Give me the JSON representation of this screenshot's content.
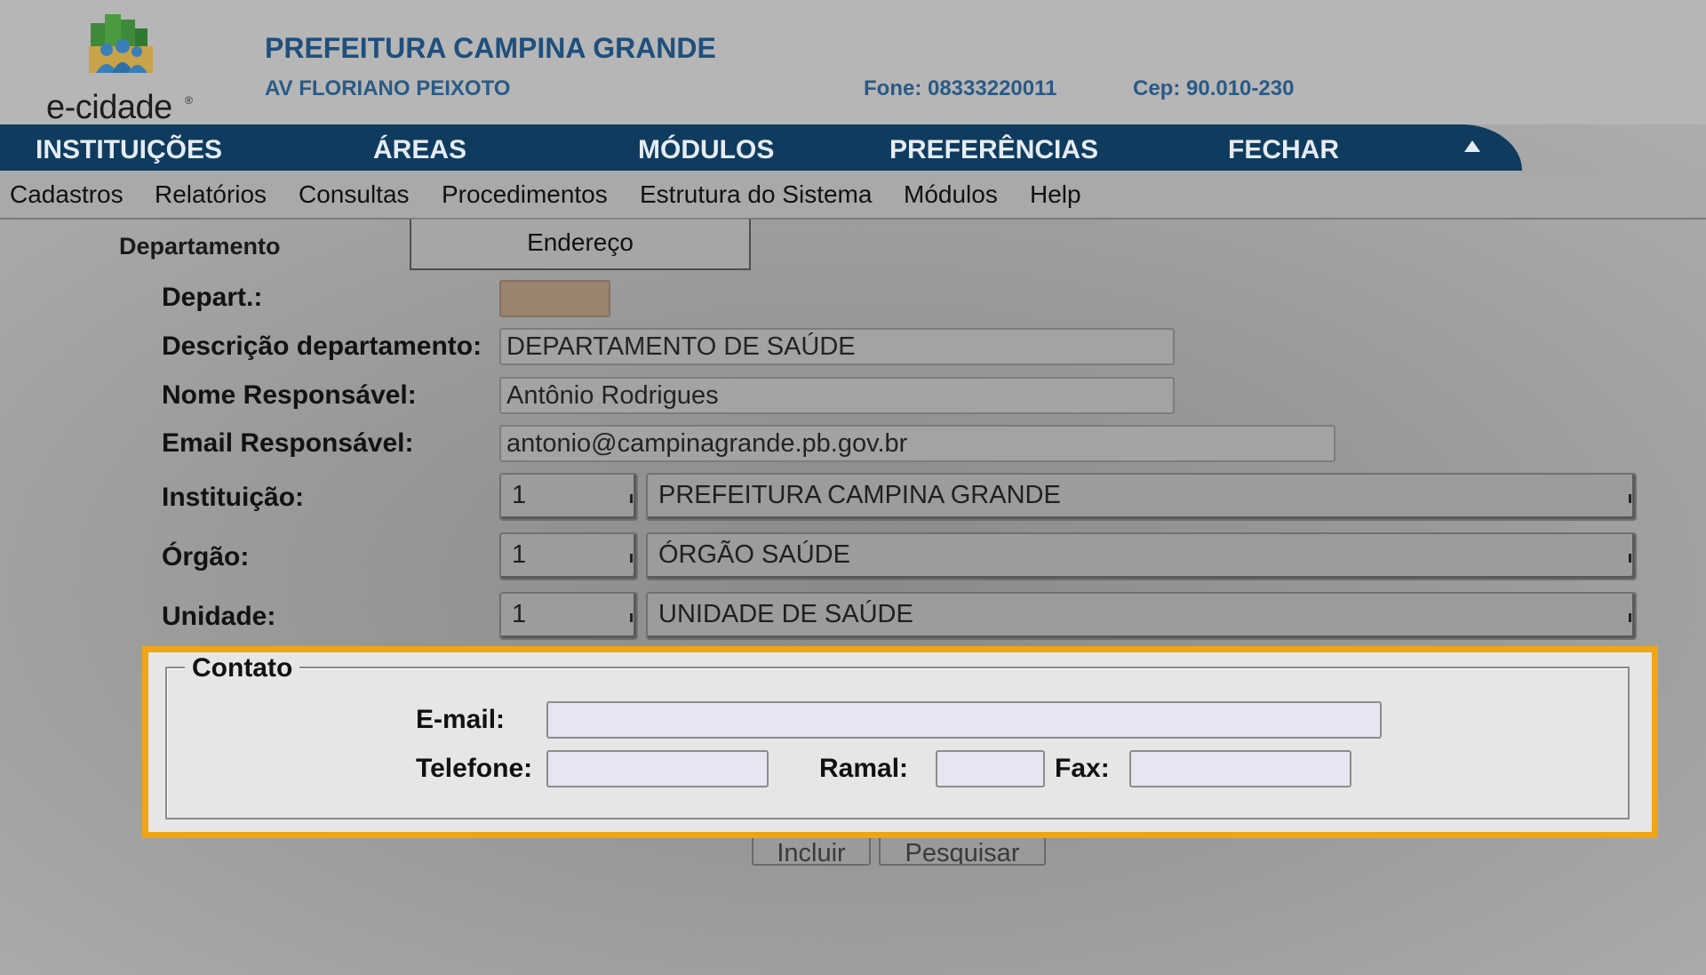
{
  "brand": {
    "logo_text": "e-cidade",
    "logo_mark": "®"
  },
  "header": {
    "title": "PREFEITURA CAMPINA GRANDE",
    "address": "AV FLORIANO PEIXOTO",
    "phone": "Fone: 08333220011",
    "cep": "Cep: 90.010-230"
  },
  "top_nav": {
    "items": [
      {
        "label": "INSTITUIÇÕES"
      },
      {
        "label": "ÁREAS"
      },
      {
        "label": "MÓDULOS"
      },
      {
        "label": "PREFERÊNCIAS"
      },
      {
        "label": "FECHAR"
      }
    ],
    "collapse_icon": "triangle-up-icon"
  },
  "menu": {
    "items": [
      {
        "label": "Cadastros"
      },
      {
        "label": "Relatórios"
      },
      {
        "label": "Consultas"
      },
      {
        "label": "Procedimentos"
      },
      {
        "label": "Estrutura do Sistema"
      },
      {
        "label": "Módulos"
      },
      {
        "label": "Help"
      }
    ]
  },
  "tabs": {
    "active": "Departamento",
    "other": "Endereço"
  },
  "form": {
    "depart_label": "Depart.:",
    "depart_value": "",
    "descricao_label": "Descrição departamento:",
    "descricao_value": "DEPARTAMENTO DE SAÚDE",
    "nome_label": "Nome Responsável:",
    "nome_value": "Antônio Rodrigues",
    "email_label": "Email Responsável:",
    "email_value": "antonio@campinagrande.pb.gov.br",
    "instituicao_label": "Instituição:",
    "instituicao_code": "1",
    "instituicao_name": "PREFEITURA CAMPINA GRANDE",
    "orgao_label": "Órgão:",
    "orgao_code": "1",
    "orgao_name": "ÓRGÃO SAÚDE",
    "unidade_label": "Unidade:",
    "unidade_code": "1",
    "unidade_name": "UNIDADE DE SAÚDE"
  },
  "contato": {
    "legend": "Contato",
    "email_label": "E-mail:",
    "telefone_label": "Telefone:",
    "ramal_label": "Ramal:",
    "fax_label": "Fax:"
  },
  "buttons": {
    "incluir": "Incluir",
    "pesquisar": "Pesquisar"
  },
  "colors": {
    "nav_bg": "#0f3c5e",
    "header_text": "#1f4f7c",
    "highlight": "#f0a515"
  }
}
